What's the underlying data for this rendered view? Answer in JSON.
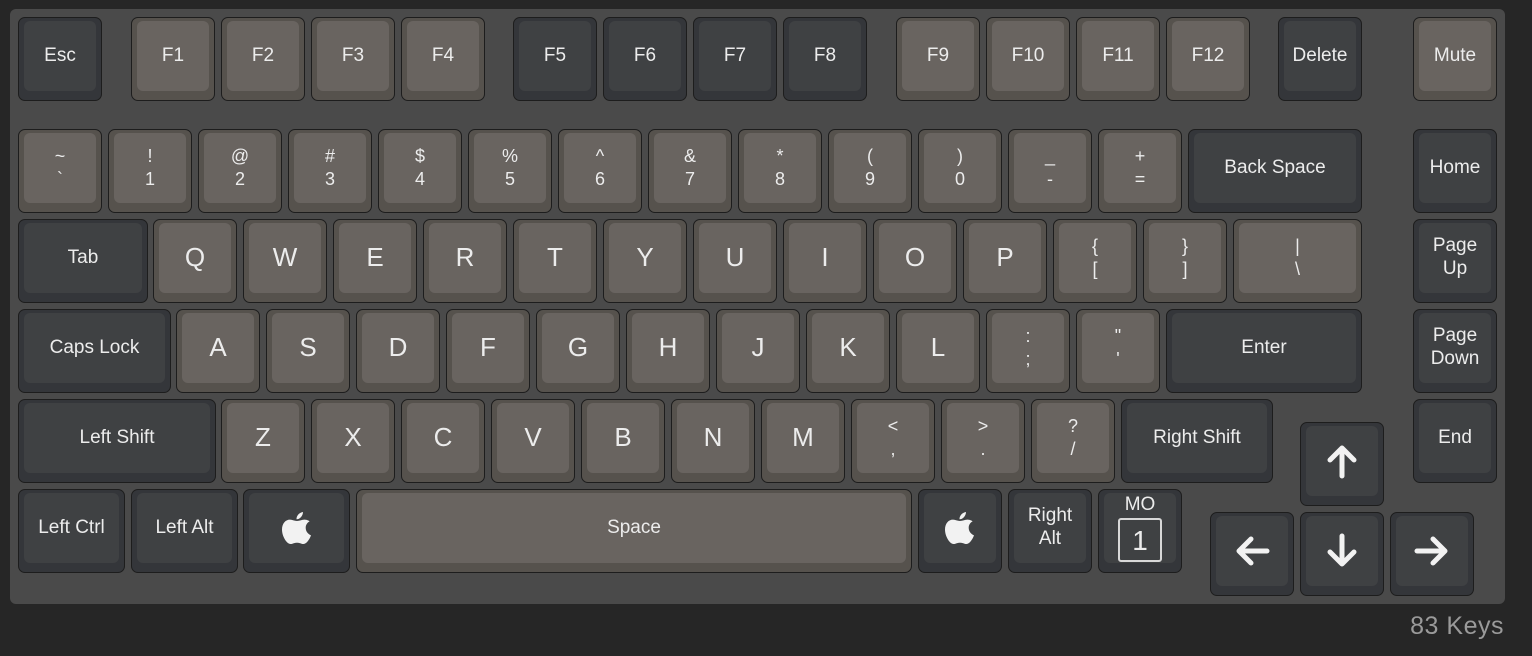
{
  "keyboard": {
    "function_row": {
      "esc": "Esc",
      "f1": "F1",
      "f2": "F2",
      "f3": "F3",
      "f4": "F4",
      "f5": "F5",
      "f6": "F6",
      "f7": "F7",
      "f8": "F8",
      "f9": "F9",
      "f10": "F10",
      "f11": "F11",
      "f12": "F12",
      "delete": "Delete",
      "mute": "Mute"
    },
    "number_row": [
      {
        "top": "~",
        "bottom": "`"
      },
      {
        "top": "!",
        "bottom": "1"
      },
      {
        "top": "@",
        "bottom": "2"
      },
      {
        "top": "#",
        "bottom": "3"
      },
      {
        "top": "$",
        "bottom": "4"
      },
      {
        "top": "%",
        "bottom": "5"
      },
      {
        "top": "^",
        "bottom": "6"
      },
      {
        "top": "&",
        "bottom": "7"
      },
      {
        "top": "*",
        "bottom": "8"
      },
      {
        "top": "(",
        "bottom": "9"
      },
      {
        "top": ")",
        "bottom": "0"
      },
      {
        "top": "_",
        "bottom": "-"
      },
      {
        "top": "+",
        "bottom": "="
      }
    ],
    "backspace": "Back Space",
    "home": "Home",
    "tab": "Tab",
    "qwerty_row": [
      "Q",
      "W",
      "E",
      "R",
      "T",
      "Y",
      "U",
      "I",
      "O",
      "P"
    ],
    "bracket_keys": [
      {
        "top": "{",
        "bottom": "["
      },
      {
        "top": "}",
        "bottom": "]"
      },
      {
        "top": "|",
        "bottom": "\\"
      }
    ],
    "page_up": {
      "line1": "Page",
      "line2": "Up"
    },
    "caps_lock": "Caps Lock",
    "home_row": [
      "A",
      "S",
      "D",
      "F",
      "G",
      "H",
      "J",
      "K",
      "L"
    ],
    "home_punct": [
      {
        "top": ":",
        "bottom": ";"
      },
      {
        "top": "\"",
        "bottom": "'"
      }
    ],
    "enter": "Enter",
    "page_down": {
      "line1": "Page",
      "line2": "Down"
    },
    "left_shift": "Left Shift",
    "bottom_letters": [
      "Z",
      "X",
      "C",
      "V",
      "B",
      "N",
      "M"
    ],
    "bottom_punct": [
      {
        "top": "<",
        "bottom": ","
      },
      {
        "top": ">",
        "bottom": "."
      },
      {
        "top": "?",
        "bottom": "/"
      }
    ],
    "right_shift": "Right Shift",
    "end": "End",
    "left_ctrl": "Left Ctrl",
    "left_alt": "Left Alt",
    "space": "Space",
    "right_alt": {
      "line1": "Right",
      "line2": "Alt"
    },
    "mo": {
      "label": "MO",
      "layer": "1"
    },
    "icons": {
      "left_cmd": "apple-logo-icon",
      "right_cmd": "apple-logo-icon",
      "up": "arrow-up-icon",
      "left": "arrow-left-icon",
      "down": "arrow-down-icon",
      "right": "arrow-right-icon"
    }
  },
  "footer": {
    "key_count": "83 Keys"
  },
  "colors": {
    "background": "#262626",
    "board": "#4a4a4a",
    "dark_keycap": "#3f4143",
    "light_keycap": "#696460",
    "legend": "#ececec"
  }
}
